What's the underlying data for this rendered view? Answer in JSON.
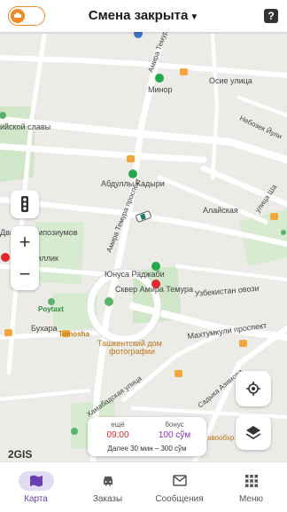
{
  "header": {
    "title": "Смена закрыта",
    "help": "?"
  },
  "map": {
    "labels": {
      "minor": "Минор",
      "osie": "Осие улица",
      "amira_temura_top": "Амира Темура",
      "nebozhek": "Небозек Йули",
      "slavy": "ийской славы",
      "abdully": "Абдуллы Кадыри",
      "alaiskaya": "Алайская",
      "amira_prospect": "Амира Темура проспект",
      "ulitsa_sh": "улица Ша",
      "dva": "Два",
      "pozumov": "мпозиумов",
      "mustakillik": "Мустакиллик",
      "yunus": "Юнуса Раджаби",
      "skver": "Сквер Амира Темура",
      "uzbekistan": "Узбекистан овози",
      "poytaxt": "Poytaxt",
      "bukhara": "Бухара",
      "tomosha": "Tomosha",
      "tashkent_dom": "Ташкентский дом",
      "fotografii": "фотографии",
      "makhtumkuli": "Махтумкули проспект",
      "sadyka": "Садыка Азимова",
      "abbasabad": "Хамабадская улица",
      "avaoxr": "авообхр"
    }
  },
  "card": {
    "left_label": "ещё",
    "left_value": "09:00",
    "right_label": "бонус",
    "right_value": "100 сўм",
    "bottom": "Далее 30 мин – 300 сўм"
  },
  "brand": "2GIS",
  "nav": {
    "items": [
      {
        "label": "Карта"
      },
      {
        "label": "Заказы"
      },
      {
        "label": "Сообщения"
      },
      {
        "label": "Меню"
      }
    ]
  },
  "colors": {
    "accent": "#f08a24",
    "primary": "#6a3fb0",
    "bonus": "#8a2fbf",
    "time": "#e0262e"
  }
}
